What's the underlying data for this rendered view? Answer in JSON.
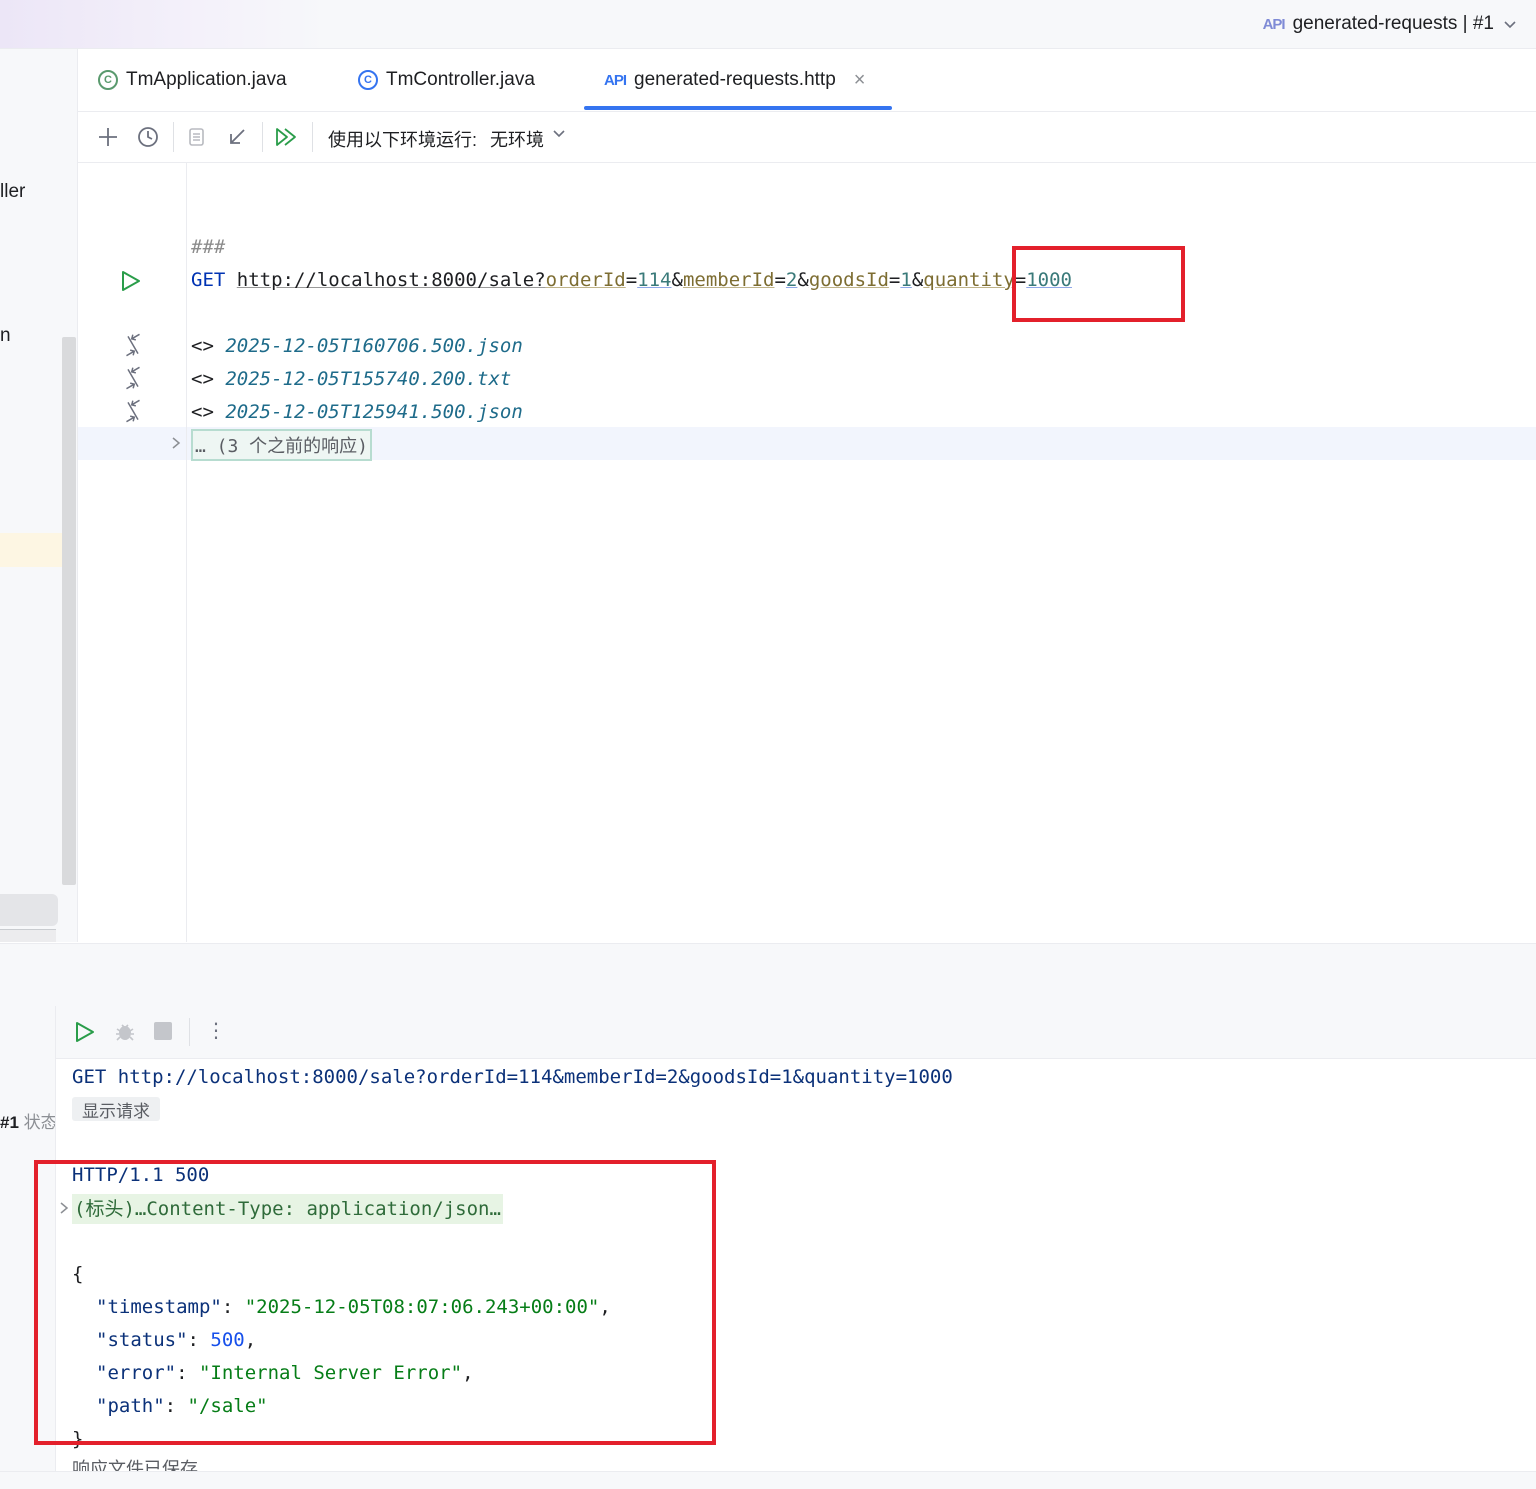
{
  "run_config": {
    "icon": "api-icon",
    "icon_text": "API",
    "label": "generated-requests | #1"
  },
  "left_strip": {
    "fragment_1": "ller",
    "fragment_2": "n"
  },
  "tabs": [
    {
      "label": "TmApplication.java",
      "icon": "spring-class-icon",
      "active": false
    },
    {
      "label": "TmController.java",
      "icon": "class-icon",
      "active": false
    },
    {
      "label": "generated-requests.http",
      "icon": "http-api-icon",
      "active": true
    }
  ],
  "toolbar": {
    "env_label": "使用以下环境运行:",
    "env_value": "无环境",
    "buttons": [
      "add-icon",
      "history-icon",
      "copy-icon",
      "import-icon",
      "run-all-icon"
    ]
  },
  "editor": {
    "separator": "###",
    "method": "GET",
    "url_base": "http://localhost:8000/sale?",
    "params": [
      {
        "name": "orderId",
        "value": "114"
      },
      {
        "name": "memberId",
        "value": "2"
      },
      {
        "name": "goodsId",
        "value": "1"
      },
      {
        "name": "quantity",
        "value": "1000"
      }
    ],
    "prefix": "<>",
    "responses": [
      "2025-12-05T160706.500.json",
      "2025-12-05T155740.200.txt",
      "2025-12-05T125941.500.json"
    ],
    "previous": "… (3 个之前的响应)"
  },
  "services": {
    "left_label_bold": "#1",
    "left_label": "状态",
    "request_line": "GET http://localhost:8000/sale?orderId=114&memberId=2&goodsId=1&quantity=1000",
    "show_request": "显示请求",
    "status_line": "HTTP/1.1 500",
    "headers_collapsed": "(标头)…Content-Type: application/json…",
    "json_open": "{",
    "json_close": "}",
    "json": [
      {
        "key": "\"timestamp\"",
        "value": "\"2025-12-05T08:07:06.243+00:00\"",
        "type": "string",
        "trail": ","
      },
      {
        "key": "\"status\"",
        "value": "500",
        "type": "number",
        "trail": ","
      },
      {
        "key": "\"error\"",
        "value": "\"Internal Server Error\"",
        "type": "string",
        "trail": ","
      },
      {
        "key": "\"path\"",
        "value": "\"/sale\"",
        "type": "string",
        "trail": ""
      }
    ],
    "saved_note": "响应文件已保存"
  }
}
